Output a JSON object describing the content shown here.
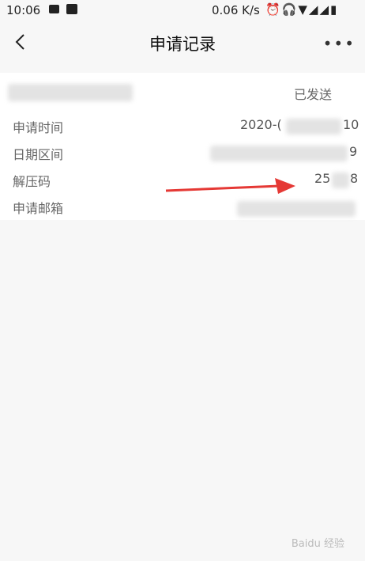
{
  "status_bar": {
    "time": "10:06",
    "net_speed": "0.06 K/s",
    "icons": [
      "image-icon",
      "notification-icon",
      "alarm-icon",
      "headset-icon",
      "wifi-icon",
      "signal-icon",
      "signal-icon-2",
      "battery-icon"
    ]
  },
  "nav": {
    "title": "申请记录",
    "back_icon": "chevron-left-icon",
    "more_icon": "more-icon"
  },
  "record": {
    "status": "已发送",
    "fields": [
      {
        "label": "申请时间",
        "value_start": "2020-(",
        "value_end": "10"
      },
      {
        "label": "日期区间",
        "value_start": "",
        "value_end": "9"
      },
      {
        "label": "解压码",
        "value_start": "25",
        "value_end": "8"
      },
      {
        "label": "申请邮箱",
        "value_start": "",
        "value_end": ""
      }
    ]
  },
  "colors": {
    "annotation_arrow": "#e53935",
    "background": "#f7f7f7",
    "card": "#ffffff"
  }
}
